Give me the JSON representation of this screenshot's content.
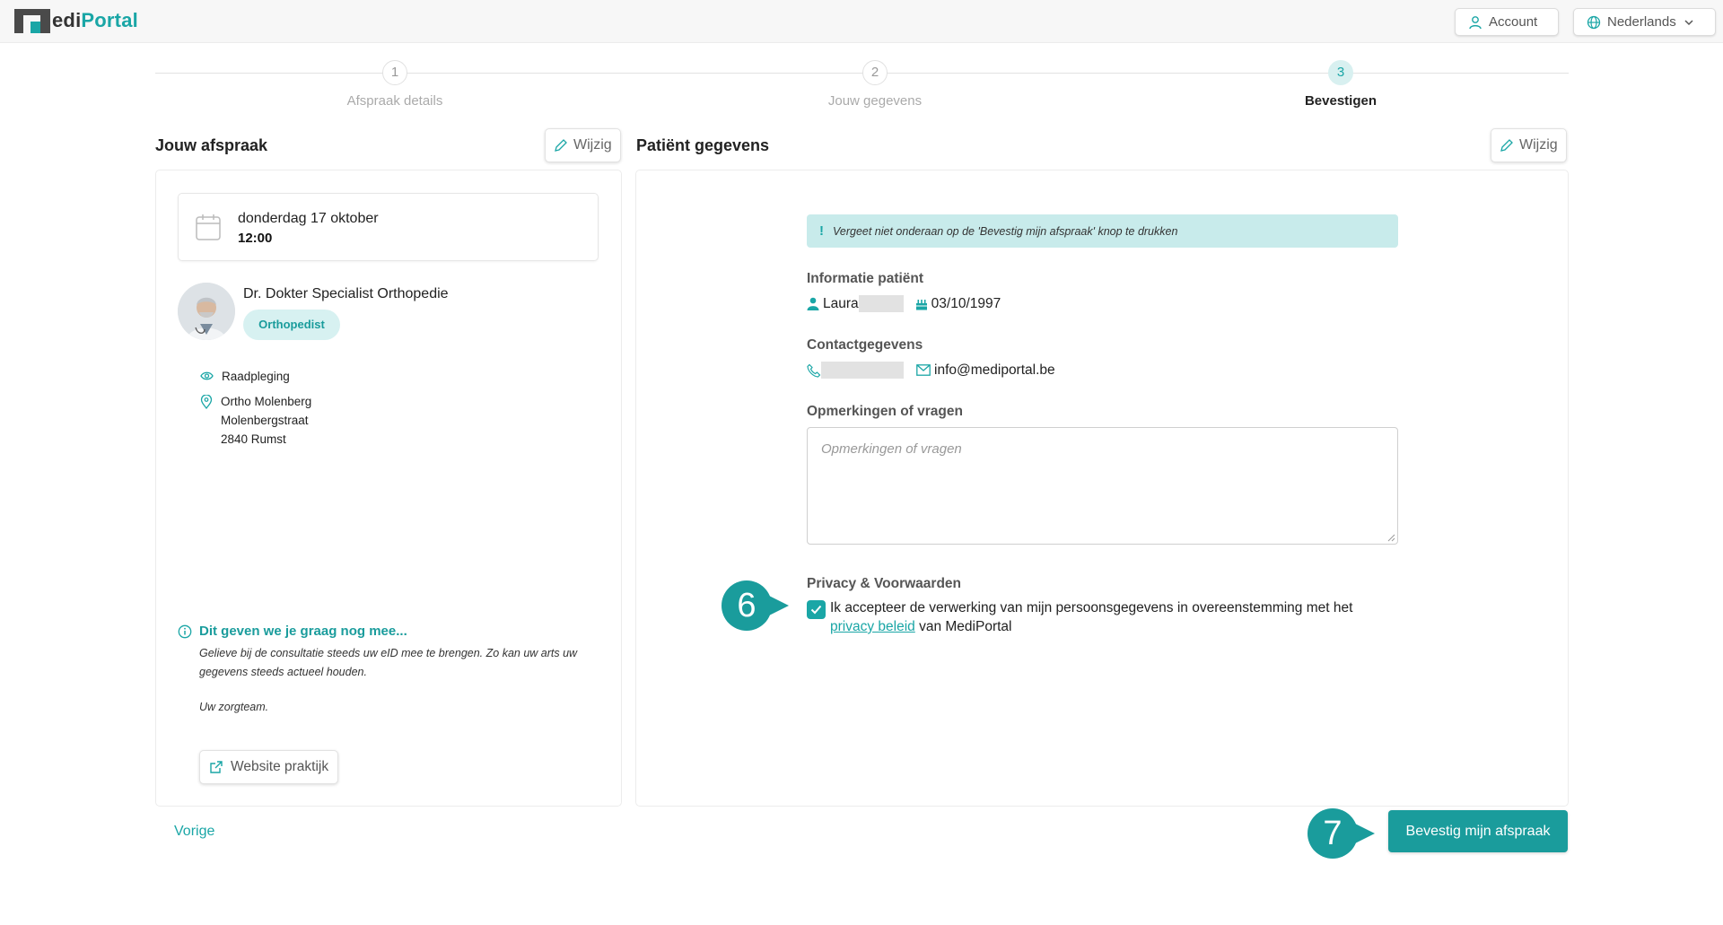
{
  "app": {
    "logo_part1": "M",
    "logo_part2": "edi",
    "logo_part3": "Portal"
  },
  "header": {
    "account_label": "Account",
    "language_label": "Nederlands"
  },
  "steps": [
    {
      "number": "1",
      "label": "Afspraak details"
    },
    {
      "number": "2",
      "label": "Jouw gegevens"
    },
    {
      "number": "3",
      "label": "Bevestigen"
    }
  ],
  "appointment": {
    "title": "Jouw afspraak",
    "edit_label": "Wijzig",
    "date": "donderdag 17 oktober",
    "time": "12:00",
    "doctor_name": "Dr. Dokter Specialist Orthopedie",
    "specialty": "Orthopedist",
    "consult_type": "Raadpleging",
    "location_line1": "Ortho Molenberg",
    "location_line2": "Molenbergstraat",
    "location_line3": "2840 Rumst",
    "tip_title": "Dit geven we je graag nog mee...",
    "tip_text": "Gelieve bij de consultatie steeds uw eID mee te brengen. Zo kan uw arts uw gegevens steeds actueel houden.",
    "tip_sign": "Uw zorgteam.",
    "website_label": "Website praktijk"
  },
  "patient": {
    "title": "Patiënt gegevens",
    "edit_label": "Wijzig",
    "alert": "Vergeet niet onderaan op de 'Bevestig mijn afspraak' knop te drukken",
    "alert_mark": "!",
    "info_label": "Informatie patiënt",
    "first_name": "Laura",
    "birth_date": "03/10/1997",
    "contact_label": "Contactgegevens",
    "email": "info@mediportal.be",
    "remarks_label": "Opmerkingen of vragen",
    "remarks_placeholder": "Opmerkingen of vragen",
    "privacy_label": "Privacy & Voorwaarden",
    "consent_text_1": "Ik accepteer de verwerking van mijn persoonsgegevens in overeenstemming met het",
    "consent_link": "privacy beleid",
    "consent_text_2": " van MediPortal",
    "consent_checked": true
  },
  "footer": {
    "previous_label": "Vorige",
    "confirm_label": "Bevestig mijn afspraak"
  },
  "annotations": {
    "marker_6": "6",
    "marker_7": "7"
  },
  "colors": {
    "accent": "#1aa6a6",
    "accent_dark": "#1a9c9c",
    "accent_light": "#d7f1f1"
  }
}
